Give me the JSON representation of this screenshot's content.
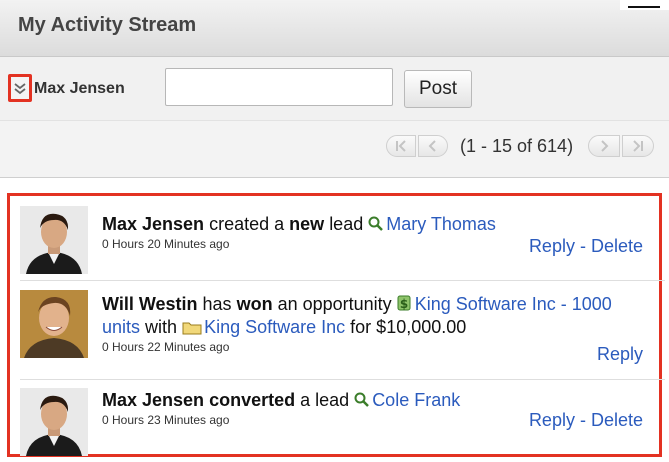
{
  "header": {
    "title": "My Activity Stream"
  },
  "post": {
    "user": "Max Jensen",
    "input_value": "",
    "button": "Post"
  },
  "pager": {
    "info": "(1 - 15 of 614)"
  },
  "colors": {
    "link": "#2b5bbd",
    "highlight": "#e33222"
  },
  "feed": [
    {
      "actor": "Max Jensen",
      "verb": "created a",
      "emphasis": "new",
      "object": "lead",
      "target_icon": "lead-icon",
      "target": "Mary Thomas",
      "time": "0 Hours 20 Minutes ago",
      "actions": [
        "Reply",
        "Delete"
      ]
    },
    {
      "actor": "Will Westin",
      "verb": "has",
      "emphasis": "won",
      "object": "an opportunity",
      "target_icon": "opportunity-icon",
      "target_part1": "King Software Inc - 1000",
      "target_part2": "units",
      "with": "with",
      "account_icon": "account-icon",
      "account": "King Software Inc",
      "for_text": "for $10,000.00",
      "time": "0 Hours 22 Minutes ago",
      "actions": [
        "Reply"
      ]
    },
    {
      "actor": "Max Jensen",
      "emphasis": "converted",
      "object": "a lead",
      "target_icon": "lead-icon",
      "target": "Cole Frank",
      "time": "0 Hours 23 Minutes ago",
      "actions": [
        "Reply",
        "Delete"
      ]
    }
  ]
}
